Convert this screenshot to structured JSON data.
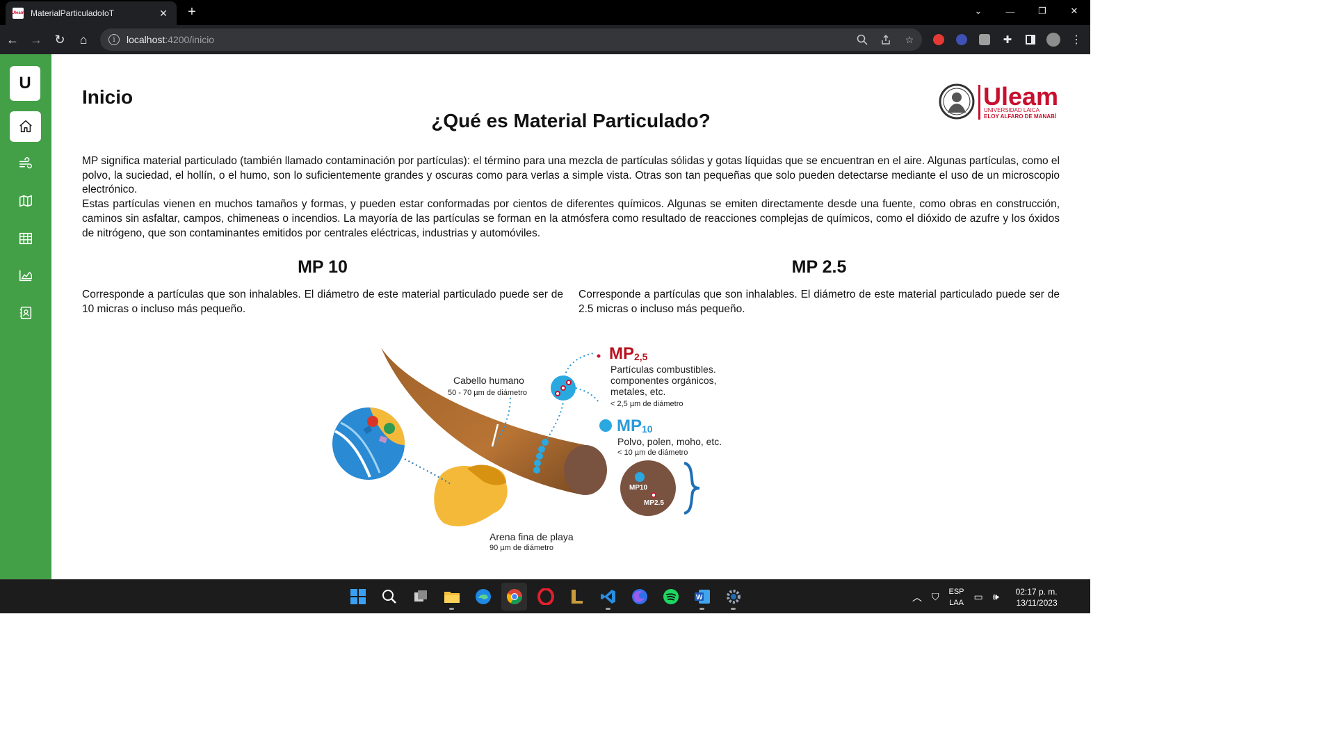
{
  "browser": {
    "tab_title": "MaterialParticuladoIoT",
    "tab_favicon_text": "Uleam",
    "url_host": "localhost",
    "url_path": ":4200/inicio"
  },
  "sidebar": {
    "logo_letter": "U",
    "items": [
      "home-icon",
      "air-flow-icon",
      "map-icon",
      "table-icon",
      "chart-icon",
      "contact-card-icon"
    ],
    "accent_color": "#43a047"
  },
  "page": {
    "title": "Inicio",
    "headline": "¿Qué es Material Particulado?",
    "logo": {
      "brand": "Uleam",
      "line1": "UNIVERSIDAD LAICA",
      "line2": "ELOY ALFARO DE MANABÍ"
    },
    "intro_p1": "MP significa material particulado (también llamado contaminación por partículas): el término para una mezcla de partículas sólidas y gotas líquidas que se encuentran en el aire. Algunas partículas, como el polvo, la suciedad, el hollín, o el humo, son lo suficientemente grandes y oscuras como para verlas a simple vista. Otras son tan pequeñas que solo pueden detectarse mediante el uso de un microscopio electrónico.",
    "intro_p2": "Estas partículas vienen en muchos tamaños y formas, y pueden estar conformadas por cientos de diferentes químicos. Algunas se emiten directamente desde una fuente, como obras en construcción, caminos sin asfaltar, campos, chimeneas o incendios. La mayoría de las partículas se forman en la atmósfera como resultado de reacciones complejas de químicos, como el dióxido de azufre y los óxidos de nitrógeno, que son contaminantes emitidos por centrales eléctricas, industrias y automóviles.",
    "mp10": {
      "heading": "MP 10",
      "text": "Corresponde a partículas que son inhalables. El diámetro de este material particulado puede ser de 10 micras o incluso más pequeño."
    },
    "mp25": {
      "heading": "MP 2.5",
      "text": "Corresponde a partículas que son inhalables. El diámetro de este material particulado puede ser de 2.5 micras o incluso más pequeño."
    }
  },
  "illustration": {
    "hair_label": "Cabello humano",
    "hair_sub": "50 - 70 µm de diámetro",
    "mp25_label": "MP",
    "mp25_sub_num": "2,5",
    "mp25_line1": "Partículas combustibles.",
    "mp25_line2": "componentes orgánicos,",
    "mp25_line3": "metales, etc.",
    "mp25_size": "< 2,5 µm de diámetro",
    "mp10_label": "MP",
    "mp10_sub_num": "10",
    "mp10_line1": "Polvo, polen, moho, etc.",
    "mp10_size": "< 10 µm de diámetro",
    "sand_label": "Arena fina de playa",
    "sand_sub": "90 µm de diámetro",
    "circle_mp10": "MP10",
    "circle_mp25": "MP2.5"
  },
  "taskbar": {
    "apps": [
      "windows-start-icon",
      "search-icon",
      "task-view-icon",
      "file-explorer-icon",
      "edge-icon",
      "chrome-icon",
      "opera-icon",
      "league-icon",
      "vscode-icon",
      "firefox-icon",
      "spotify-icon",
      "word-icon",
      "settings-icon"
    ],
    "lang_top": "ESP",
    "lang_bottom": "LAA",
    "time": "02:17 p. m.",
    "date": "13/11/2023"
  }
}
